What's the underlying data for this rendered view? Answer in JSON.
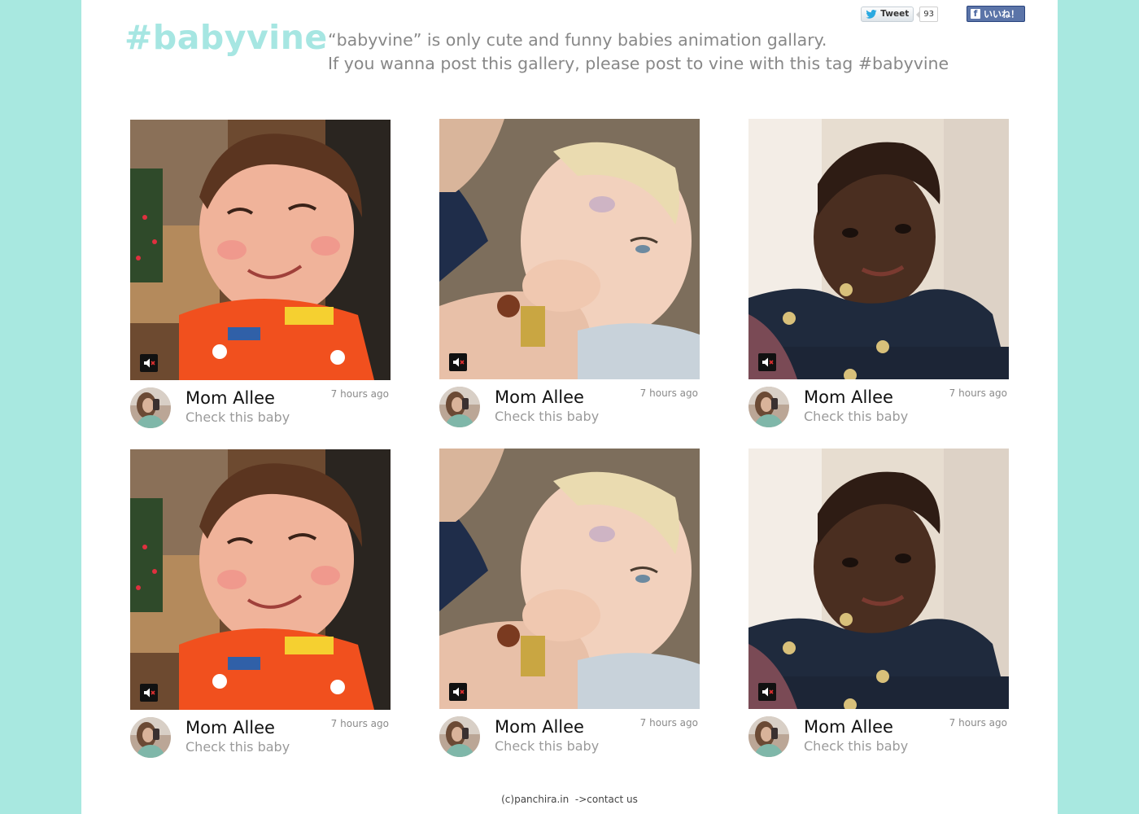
{
  "header": {
    "logo": "#babyvine",
    "tagline_line1": "“babyvine” is only cute and funny babies animation gallary.",
    "tagline_line2": "If you wanna post this gallery, please post to vine with this tag #babyvine"
  },
  "social": {
    "tweet_label": "Tweet",
    "tweet_count": "93",
    "like_label": "いいね！",
    "like_icon": "f"
  },
  "cards": [
    {
      "user": "Mom Allee",
      "caption": "Check this baby",
      "time": "7 hours ago",
      "photo": "toddler-red-pajamas"
    },
    {
      "user": "Mom Allee",
      "caption": "Check this baby",
      "time": "7 hours ago",
      "photo": "blond-baby-eating"
    },
    {
      "user": "Mom Allee",
      "caption": "Check this baby",
      "time": "7 hours ago",
      "photo": "baby-denim-jacket"
    },
    {
      "user": "Mom Allee",
      "caption": "Check this baby",
      "time": "7 hours ago",
      "photo": "toddler-red-pajamas"
    },
    {
      "user": "Mom Allee",
      "caption": "Check this baby",
      "time": "7 hours ago",
      "photo": "blond-baby-eating"
    },
    {
      "user": "Mom Allee",
      "caption": "Check this baby",
      "time": "7 hours ago",
      "photo": "baby-denim-jacket"
    }
  ],
  "footer": {
    "copyright": "(c)panchira.in",
    "contact": "->contact us"
  },
  "colors": {
    "background": "#a8e8e0",
    "logo": "#a6e6e2",
    "tagline": "#888888",
    "facebook": "#5b74a8"
  }
}
